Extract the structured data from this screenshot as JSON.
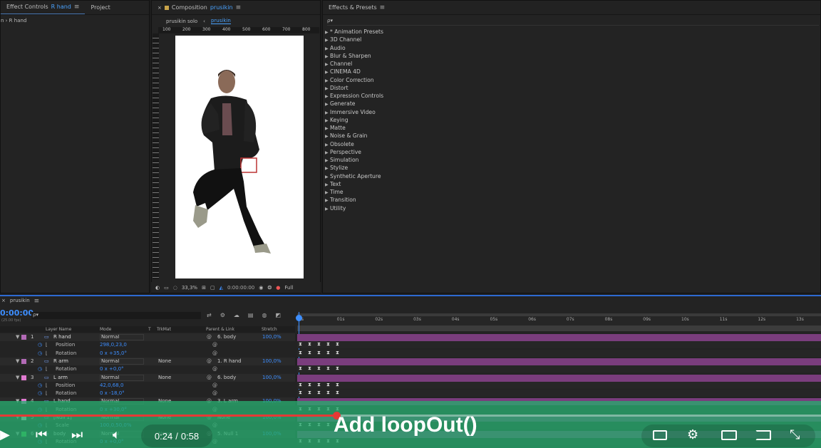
{
  "effect_controls": {
    "tab_label": "Effect Controls",
    "tab_layer": "R hand",
    "project_tab": "Project",
    "sub_label": "n › R hand"
  },
  "composition": {
    "tab_prefix": "Composition",
    "tab_name": "prusikin",
    "breadcrumb_1": "prusikin solo",
    "breadcrumb_2": "prusikin",
    "ruler_marks": [
      "100",
      "200",
      "300",
      "400",
      "500",
      "600",
      "700",
      "800"
    ],
    "zoom": "33,3%",
    "timecode": "0:00:00:00",
    "resolution": "Full"
  },
  "effects_presets": {
    "title": "Effects & Presets",
    "search_placeholder": "ρ▾",
    "items": [
      "* Animation Presets",
      "3D Channel",
      "Audio",
      "Blur & Sharpen",
      "Channel",
      "CINEMA 4D",
      "Color Correction",
      "Distort",
      "Expression Controls",
      "Generate",
      "Immersive Video",
      "Keying",
      "Matte",
      "Noise & Grain",
      "Obsolete",
      "Perspective",
      "Simulation",
      "Stylize",
      "Synthetic Aperture",
      "Text",
      "Time",
      "Transition",
      "Utility"
    ]
  },
  "timeline": {
    "comp_tab": "prusikin",
    "timecode": "0:00:00",
    "fps": "(25.00 fps)",
    "search_placeholder": "ρ▾",
    "headers": {
      "layer_name": "Layer Name",
      "mode": "Mode",
      "t": "T",
      "trkmat": "TrkMat",
      "parent": "Parent & Link",
      "stretch": "Stretch"
    },
    "time_marks": [
      "0s",
      "01s",
      "02s",
      "03s",
      "04s",
      "05s",
      "06s",
      "07s",
      "08s",
      "09s",
      "10s",
      "11s",
      "12s",
      "13s"
    ],
    "rows": [
      {
        "kind": "layer",
        "num": "1",
        "name": "R hand",
        "mode": "Normal",
        "trkmat": "",
        "parent": "6. body",
        "stretch": "100,0%",
        "color": "#b36ab6"
      },
      {
        "kind": "prop",
        "name": "Position",
        "value": "298,0,23,0"
      },
      {
        "kind": "prop",
        "name": "Rotation",
        "value": "0 x +35,0°"
      },
      {
        "kind": "layer",
        "num": "2",
        "name": "R arm",
        "mode": "Normal",
        "trkmat": "None",
        "parent": "1. R hand",
        "stretch": "100,0%",
        "color": "#b36ab6"
      },
      {
        "kind": "prop",
        "name": "Rotation",
        "value": "0 x +0,0°"
      },
      {
        "kind": "layer",
        "num": "3",
        "name": "L arm",
        "mode": "Normal",
        "trkmat": "None",
        "parent": "6. body",
        "stretch": "100,0%",
        "color": "#e07ad0"
      },
      {
        "kind": "prop",
        "name": "Position",
        "value": "42,0,68,0"
      },
      {
        "kind": "prop",
        "name": "Rotation",
        "value": "0 x -18,0°"
      },
      {
        "kind": "layer",
        "num": "4",
        "name": "L hand",
        "mode": "Normal",
        "trkmat": "None",
        "parent": "3. L arm",
        "stretch": "100,0%",
        "color": "#e07ad0"
      },
      {
        "kind": "prop",
        "name": "Rotation",
        "value": "0 x +30,0°"
      },
      {
        "kind": "layer",
        "num": "5",
        "name": "[Null 1]",
        "mode": "Normal",
        "trkmat": "None",
        "parent": "None",
        "stretch": "100,0%",
        "color": "#dddddd"
      },
      {
        "kind": "prop",
        "name": "Scale",
        "value": "100,0,50,0%"
      },
      {
        "kind": "layer",
        "num": "6",
        "name": "body",
        "mode": "Normal",
        "trkmat": "None",
        "parent": "5. Null 1",
        "stretch": "100,0%",
        "color": "#44cc44"
      },
      {
        "kind": "prop",
        "name": "Rotation",
        "value": "0 x +0,0°"
      }
    ]
  },
  "player": {
    "caption": "Add loopOut()",
    "time_current": "0:24",
    "time_separator": "/",
    "time_total": "0:58",
    "progress": 0.41
  },
  "colors": {
    "accent": "#3d8eff",
    "overlay": "#28aa6e",
    "layer_purple": "#7a3d7d"
  }
}
